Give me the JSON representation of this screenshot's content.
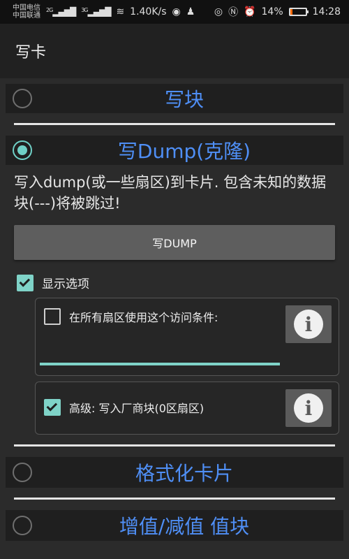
{
  "status": {
    "carrier1": "中国电信",
    "carrier2": "中国联通",
    "net1": "2G",
    "net2": "3G",
    "speed": "1.40K/s",
    "battery_percent": "14%",
    "battery_level": 0.14,
    "time": "14:28",
    "icons": [
      "signal-icon",
      "wifi-icon",
      "eye-icon",
      "nfc-icon",
      "alarm-icon",
      "battery-icon"
    ]
  },
  "appbar": {
    "title": "写卡"
  },
  "sections": {
    "write_block": "写块",
    "write_dump": "写Dump(克隆)",
    "format": "格式化卡片",
    "value": "增值/减值 值块"
  },
  "dump": {
    "description": "写入dump(或一些扇区)到卡片. 包含未知的数据块(---)将被跳过!",
    "button_label": "写DUMP",
    "show_options_label": "显示选项",
    "show_options_checked": true,
    "access_label": "在所有扇区使用这个访问条件:",
    "access_checked": false,
    "access_input_value": "",
    "advanced_label": "高级: 写入厂商块(0区扇区)",
    "advanced_checked": true,
    "info_symbol": "i"
  },
  "colors": {
    "accent_blue": "#4f8ff6",
    "teal": "#7fd3c8",
    "battery_low": "#ff6a00"
  }
}
